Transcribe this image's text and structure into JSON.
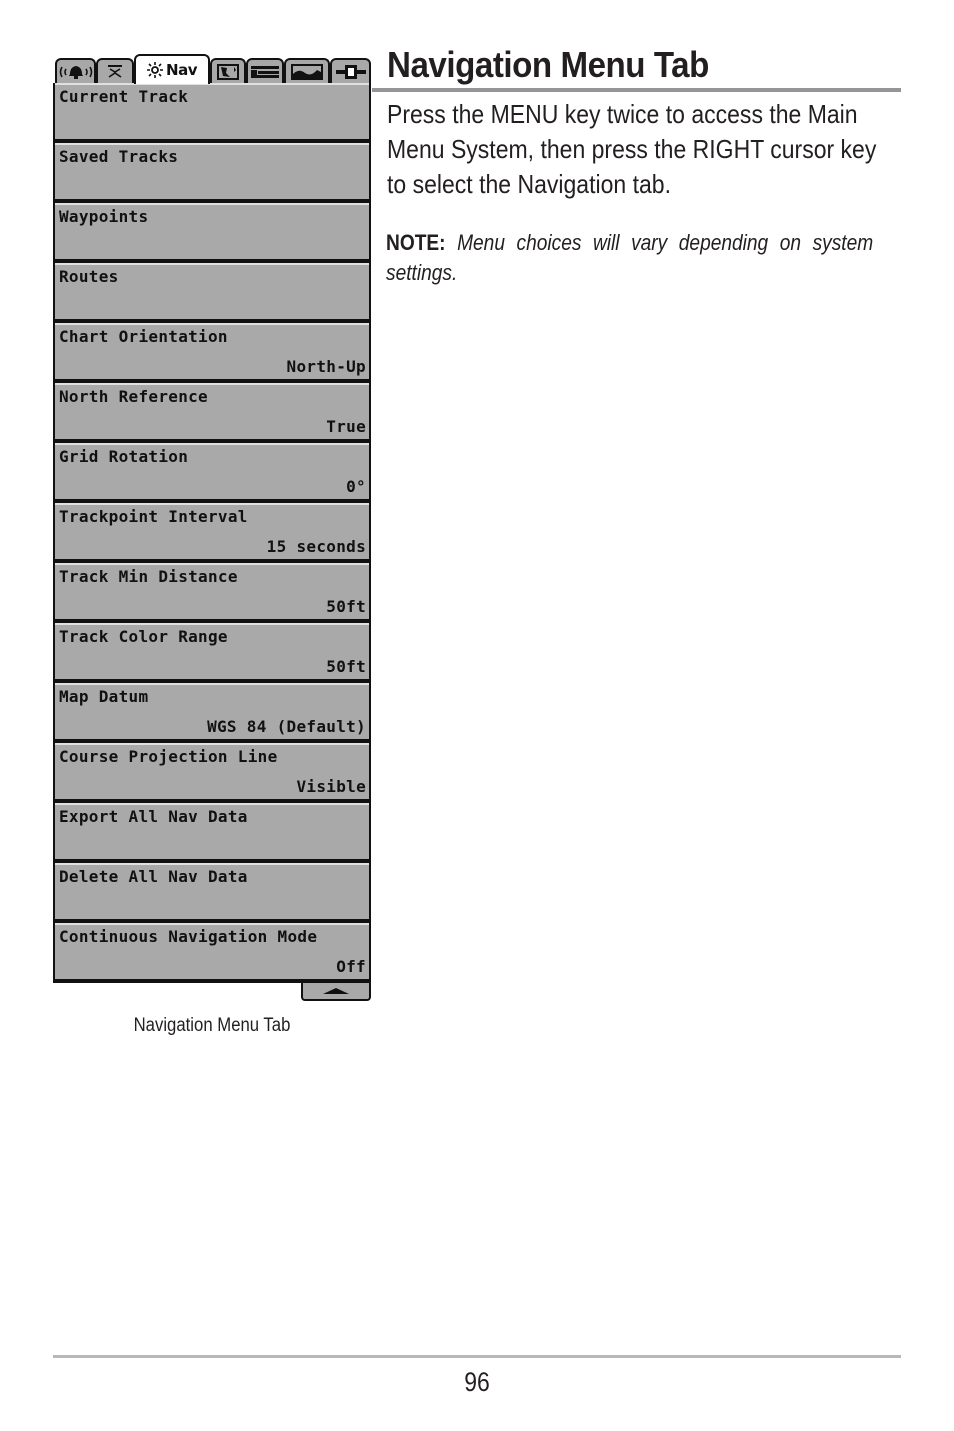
{
  "menu": {
    "tabs": [
      {
        "name": "alarms",
        "icon": "alarm-bell-icon",
        "label": ""
      },
      {
        "name": "sonar",
        "icon": "sonar-icon",
        "label": ""
      },
      {
        "name": "navigation",
        "icon": "sun-icon",
        "label": "Nav",
        "active": true
      },
      {
        "name": "chart",
        "icon": "chart-map-icon",
        "label": ""
      },
      {
        "name": "setup",
        "icon": "setup-wrench-icon",
        "label": ""
      },
      {
        "name": "views",
        "icon": "views-icon",
        "label": ""
      },
      {
        "name": "accessories",
        "icon": "accessories-icon",
        "label": ""
      }
    ],
    "items": [
      {
        "label": "Current Track",
        "value": ""
      },
      {
        "label": "Saved Tracks",
        "value": ""
      },
      {
        "label": "Waypoints",
        "value": ""
      },
      {
        "label": "Routes",
        "value": ""
      },
      {
        "label": "Chart Orientation",
        "value": "North-Up"
      },
      {
        "label": "North Reference",
        "value": "True"
      },
      {
        "label": "Grid Rotation",
        "value": "0°"
      },
      {
        "label": "Trackpoint Interval",
        "value": "15 seconds"
      },
      {
        "label": "Track Min Distance",
        "value": "50ft"
      },
      {
        "label": "Track Color Range",
        "value": "50ft"
      },
      {
        "label": "Map Datum",
        "value": "WGS 84 (Default)"
      },
      {
        "label": "Course Projection Line",
        "value": "Visible"
      },
      {
        "label": "Export All Nav Data",
        "value": ""
      },
      {
        "label": "Delete All Nav Data",
        "value": ""
      },
      {
        "label": "Continuous Navigation Mode",
        "value": "Off"
      }
    ],
    "scroll_icon": "scroll-up-arrow-icon",
    "caption": "Navigation Menu Tab"
  },
  "content": {
    "title": "Navigation Menu Tab",
    "body": "Press the MENU key twice to access the Main Menu System, then press the RIGHT cursor key to select the Navigation tab.",
    "note_label": "NOTE:",
    "note_text": " Menu choices will vary depending on system settings."
  },
  "footer": {
    "page_number": "96"
  },
  "colors": {
    "menu_item_bg": "#a9a9a9",
    "menu_border": "#111111",
    "title_rule": "#939598",
    "text": "#231f20"
  }
}
